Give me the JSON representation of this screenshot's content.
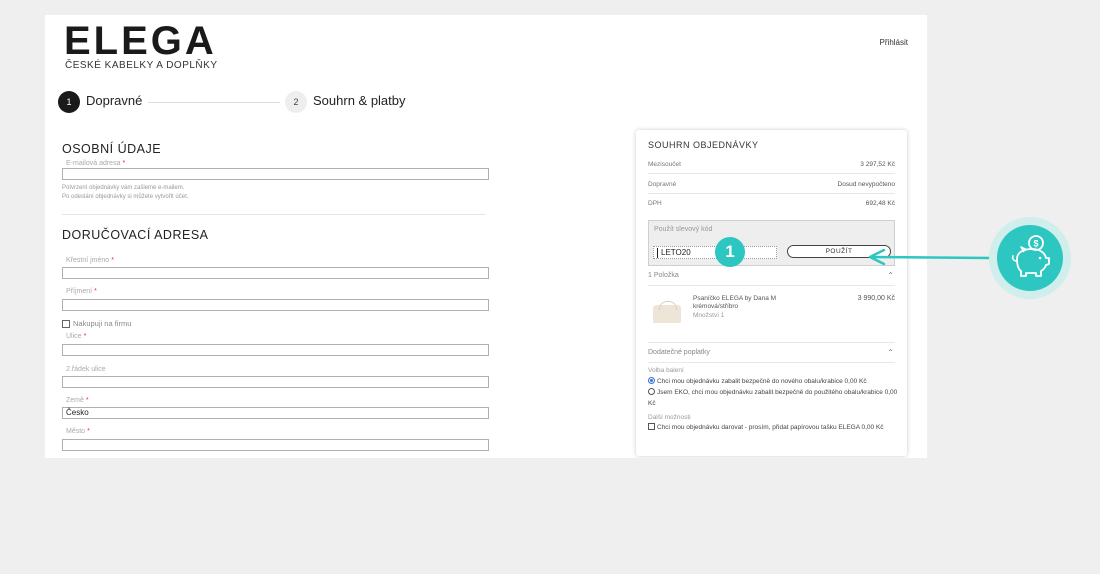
{
  "header": {
    "logo_title": "ELEGA",
    "logo_subtitle": "ČESKÉ KABELKY A DOPLŇKY",
    "login_label": "Přihlásit"
  },
  "steps": [
    {
      "number": "1",
      "label": "Dopravné"
    },
    {
      "number": "2",
      "label": "Souhrn & platby"
    }
  ],
  "personal": {
    "title": "OSOBNÍ ÚDAJE",
    "email_label": "E-mailová adresa",
    "email_value": "",
    "hint_1": "Potvrzení objednávky vám zašleme e-mailem.",
    "hint_2": "Po odeslání objednávky si můžete vytvořit účet."
  },
  "delivery": {
    "title": "DORUČOVACÍ ADRESA",
    "first_name_label": "Křestní jméno",
    "last_name_label": "Příjmení",
    "company_label": "Nakupuji na firmu",
    "street_label": "Ulice",
    "street2_label": "2.řádek ulice",
    "country_label": "Země",
    "country_value": "Česko",
    "city_label": "Město",
    "required_mark": "*"
  },
  "summary": {
    "title": "SOUHRN OBJEDNÁVKY",
    "rows": [
      {
        "label": "Mezisoučet",
        "value": "3 297,52 Kč"
      },
      {
        "label": "Dopravné",
        "value": "Dosud nevypočteno"
      },
      {
        "label": "DPH",
        "value": "692,48 Kč"
      }
    ],
    "coupon_label": "Použít slevový kód",
    "coupon_value": "LETO20",
    "coupon_button": "POUŽÍT",
    "items_header": "1 Položka",
    "product_name": "Psaníčko ELEGA by Dana M krémová/stříbro",
    "product_qty": "Množství 1",
    "product_price": "3 990,00 Kč",
    "fees_header": "Dodatečné poplatky",
    "packaging_label": "Volba balení",
    "packaging_opt1": "Chci mou objednávku zabalit bezpečně do nového obalu/krabice 0,00 Kč",
    "packaging_opt2": "Jsem EKO, chci mou objednávku zabalit bezpečně do použitého obalu/krabice 0,00 Kč",
    "other_label": "Další možnosti",
    "other_opt1": "Chci mou objednávku darovat - prosím, přidat papírovou tašku ELEGA 0,00 Kč"
  },
  "annotation": {
    "badge_number": "1",
    "accent_color": "#2ec6c0",
    "icon": "piggy-bank-coin-icon"
  }
}
